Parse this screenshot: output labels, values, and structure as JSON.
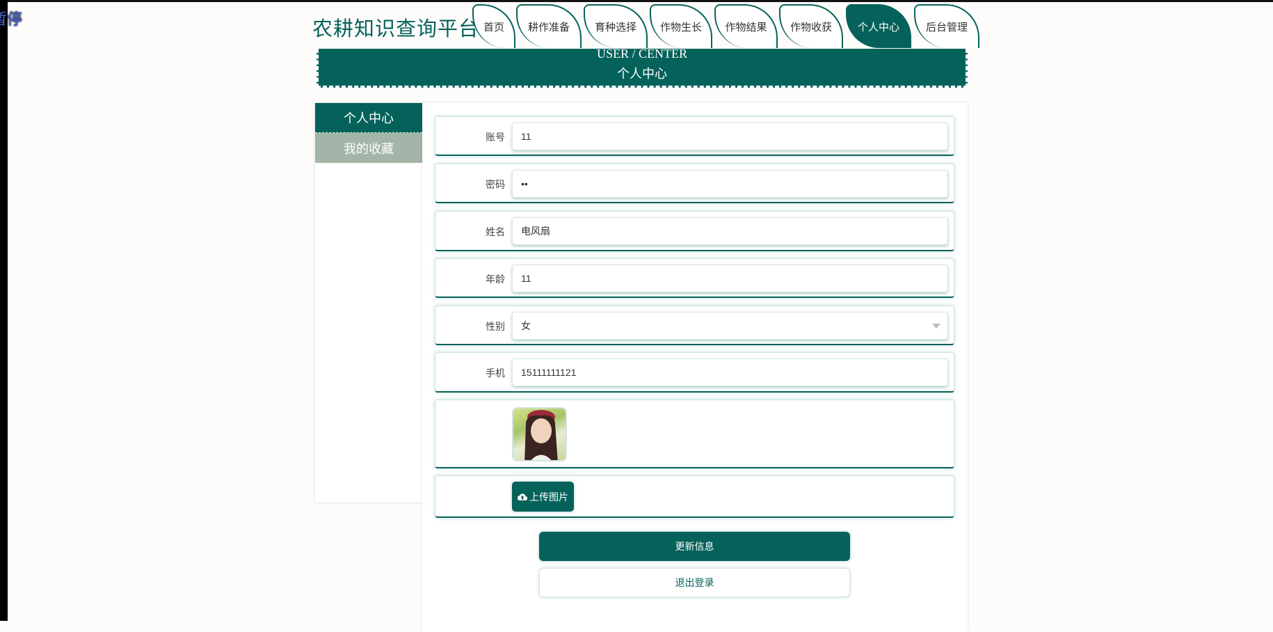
{
  "overlay": {
    "pause_text": "暂停"
  },
  "header": {
    "site_title": "农耕知识查询平台"
  },
  "nav": {
    "tabs": [
      {
        "label": "首页"
      },
      {
        "label": "耕作准备"
      },
      {
        "label": "育种选择"
      },
      {
        "label": "作物生长"
      },
      {
        "label": "作物结果"
      },
      {
        "label": "作物收获"
      },
      {
        "label": "个人中心",
        "active": true
      },
      {
        "label": "后台管理"
      }
    ]
  },
  "banner": {
    "en": "USER / CENTER",
    "cn": "个人中心"
  },
  "sidebar": {
    "items": [
      {
        "label": "个人中心",
        "active": true
      },
      {
        "label": "我的收藏"
      }
    ]
  },
  "form": {
    "account": {
      "label": "账号",
      "value": "11"
    },
    "password": {
      "label": "密码",
      "value": "••"
    },
    "name": {
      "label": "姓名",
      "value": "电风扇"
    },
    "age": {
      "label": "年龄",
      "value": "11"
    },
    "gender": {
      "label": "性别",
      "value": "女"
    },
    "phone": {
      "label": "手机",
      "value": "15111111121"
    },
    "upload_label": "上传图片",
    "update_label": "更新信息",
    "logout_label": "退出登录"
  },
  "colors": {
    "primary": "#05625a",
    "sidebar_alt": "#a3b5a8"
  }
}
